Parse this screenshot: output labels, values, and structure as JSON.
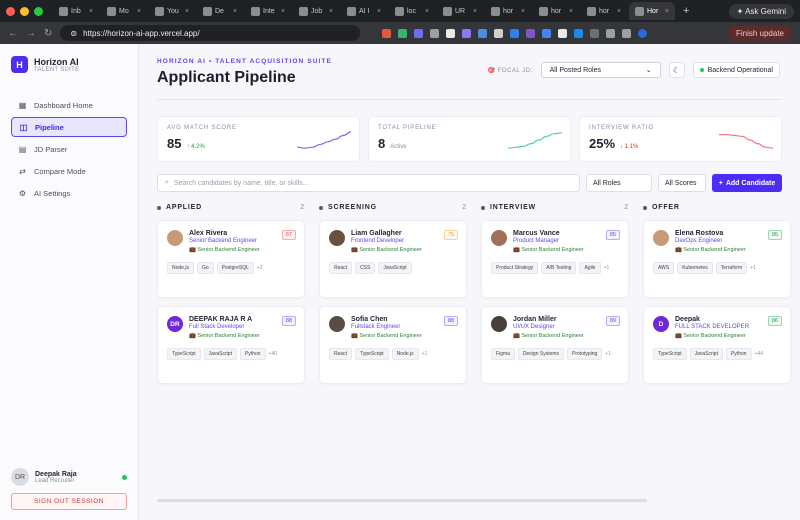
{
  "browser": {
    "tabs": [
      {
        "label": "Inb",
        "active": false
      },
      {
        "label": "Mo",
        "active": false
      },
      {
        "label": "You",
        "active": false
      },
      {
        "label": "De",
        "active": false
      },
      {
        "label": "Inte",
        "active": false
      },
      {
        "label": "Job",
        "active": false
      },
      {
        "label": "AI I",
        "active": false
      },
      {
        "label": "loc",
        "active": false
      },
      {
        "label": "UR",
        "active": false
      },
      {
        "label": "hor",
        "active": false
      },
      {
        "label": "hor",
        "active": false
      },
      {
        "label": "hor",
        "active": false
      },
      {
        "label": "Hor",
        "active": true
      }
    ],
    "ask_gemini": "Ask Gemini",
    "url": "https://horizon-ai-app.vercel.app/",
    "finish_update": "Finish update"
  },
  "sidebar": {
    "brand_name": "Horizon AI",
    "brand_sub": "TALENT SUITE",
    "logo_letter": "H",
    "items": [
      {
        "label": "Dashboard Home",
        "icon": "grid-icon",
        "glyph": "▦"
      },
      {
        "label": "Pipeline",
        "icon": "pipeline-icon",
        "glyph": "◫"
      },
      {
        "label": "JD Parser",
        "icon": "document-icon",
        "glyph": "▤"
      },
      {
        "label": "Compare Mode",
        "icon": "swap-icon",
        "glyph": "⇄"
      },
      {
        "label": "AI Settings",
        "icon": "gear-icon",
        "glyph": "⚙"
      }
    ],
    "user": {
      "initials": "DR",
      "name": "Deepak Raja",
      "role": "Lead Recruiter"
    },
    "signout": "SIGN OUT SESSION"
  },
  "header": {
    "kicker": "HORIZON AI • TALENT ACQUISITION SUITE",
    "title": "Applicant Pipeline",
    "focus_label": "FOCAL JD:",
    "focus_value": "All Posted Roles",
    "status": "Backend Operational"
  },
  "stats": [
    {
      "label": "AVG MATCH SCORE",
      "value": "85",
      "delta": "↑ 4.2%",
      "delta_color": "#16a34a",
      "line_color": "#7c6cf0"
    },
    {
      "label": "TOTAL PIPELINE",
      "value": "8",
      "delta": "Active",
      "delta_color": "#8a8ea0",
      "line_color": "#4fd1a5"
    },
    {
      "label": "INTERVIEW RATIO",
      "value": "25%",
      "delta": "↓ 1.1%",
      "delta_color": "#dc2626",
      "line_color": "#f07a8a"
    }
  ],
  "toolbar": {
    "search_placeholder": "Search candidates by name, title, or skills...",
    "roles": "All Roles",
    "scores": "All Scores",
    "add": "Add Candidate"
  },
  "columns": [
    {
      "name": "APPLIED",
      "count": "2",
      "cards": [
        {
          "name": "Alex Rivera",
          "role": "Senior Backend Engineer",
          "focus": "💼 Senior Backend Engineer",
          "score": "67",
          "score_color": "#e5484d",
          "initials": "",
          "tags": [
            "Node.js",
            "Go",
            "PostgreSQL"
          ],
          "more": "+2"
        },
        {
          "name": "DEEPAK RAJA R A",
          "role": "Full Stack Developer",
          "focus": "💼 Senior Backend Engineer",
          "score": "88",
          "score_color": "#5b47f0",
          "initials": "DR",
          "tags": [
            "TypeScript",
            "JavaScript",
            "Python"
          ],
          "more": "+40"
        }
      ]
    },
    {
      "name": "SCREENING",
      "count": "2",
      "cards": [
        {
          "name": "Liam Gallagher",
          "role": "Frontend Developer",
          "focus": "💼 Senior Backend Engineer",
          "score": "75",
          "score_color": "#f59e0b",
          "initials": "",
          "tags": [
            "React",
            "CSS",
            "JavaScript"
          ],
          "more": ""
        },
        {
          "name": "Sofia Chen",
          "role": "Fullstack Engineer",
          "focus": "💼 Senior Backend Engineer",
          "score": "88",
          "score_color": "#5b47f0",
          "initials": "",
          "tags": [
            "React",
            "TypeScript",
            "Node.js"
          ],
          "more": "+1"
        }
      ]
    },
    {
      "name": "INTERVIEW",
      "count": "2",
      "cards": [
        {
          "name": "Marcus Vance",
          "role": "Product Manager",
          "focus": "💼 Senior Backend Engineer",
          "score": "85",
          "score_color": "#5b47f0",
          "initials": "",
          "tags": [
            "Product Strategy",
            "A/B Testing",
            "Agile"
          ],
          "more": "+1"
        },
        {
          "name": "Jordan Miller",
          "role": "UI/UX Designer",
          "focus": "💼 Senior Backend Engineer",
          "score": "89",
          "score_color": "#5b47f0",
          "initials": "",
          "tags": [
            "Figma",
            "Design Systems",
            "Prototyping"
          ],
          "more": "+1"
        }
      ]
    },
    {
      "name": "OFFER",
      "count": "",
      "cards": [
        {
          "name": "Elena Rostova",
          "role": "DevOps Engineer",
          "focus": "💼 Senior Backend Engineer",
          "score": "95",
          "score_color": "#16a34a",
          "initials": "",
          "tags": [
            "AWS",
            "Kubernetes",
            "Terraform"
          ],
          "more": "+1"
        },
        {
          "name": "Deepak",
          "role": "FULL STACK DEVELOPER",
          "focus": "💼 Senior Backend Engineer",
          "score": "86",
          "score_color": "#16a34a",
          "initials": "D",
          "tags": [
            "TypeScript",
            "JavaScript",
            "Python"
          ],
          "more": "+44"
        }
      ]
    }
  ]
}
